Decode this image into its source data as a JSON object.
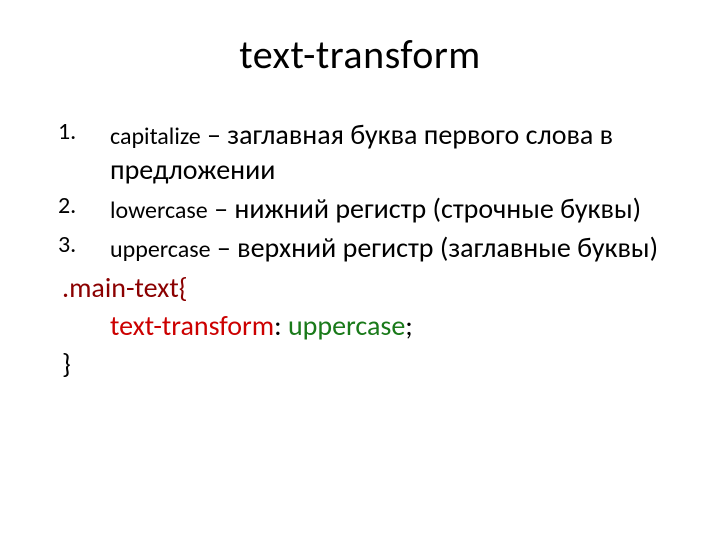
{
  "title": "text-transform",
  "items": [
    {
      "term": "capitalize",
      "desc": " – заглавная буква первого слова в предложении"
    },
    {
      "term": "lowercase",
      "desc": " – нижний регистр (строчные буквы)"
    },
    {
      "term": "uppercase",
      "desc": " – верхний регистр (заглавные буквы)"
    }
  ],
  "code": {
    "selector": ".main-text{",
    "property": "text-transform",
    "colon": ": ",
    "value": "uppercase",
    "semicolon": ";",
    "close": " }"
  }
}
